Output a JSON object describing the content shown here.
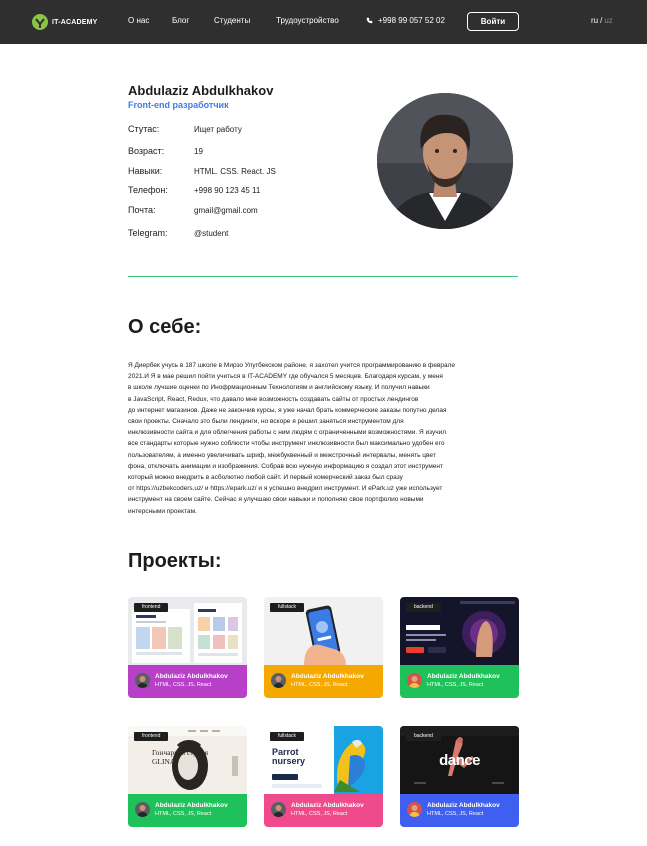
{
  "header": {
    "logo_text": "IT-ACADEMY",
    "nav": [
      "О нас",
      "Блог",
      "Студенты",
      "Трудоустройство"
    ],
    "phone": "+998 99 057 52 02",
    "login_label": "Войти",
    "lang_active": "ru",
    "lang_separator": "/",
    "lang_inactive": "uz",
    "colors": {
      "background": "#2f2f2f",
      "logo_green": "#8bc34a"
    }
  },
  "profile": {
    "name": "Abdulaziz Abdulkhakov",
    "role": "Front-end разработчик",
    "fields": [
      {
        "label": "Стутас:",
        "value": "Ищет работу"
      },
      {
        "label": "Возраст:",
        "value": "19"
      },
      {
        "label": "Навыки:",
        "value": "HTML. CSS. React. JS"
      },
      {
        "label": "Телефон:",
        "value": "+998 90 123 45 11"
      },
      {
        "label": "Почта:",
        "value": "gmail@gmail.com"
      },
      {
        "label": "Telegram:",
        "value": "@student"
      }
    ],
    "colors": {
      "role": "#3f7be8",
      "divider": "#3ec67c"
    }
  },
  "about": {
    "title": "О себе:",
    "lines": [
      "Я Диербек учусь в 187 школе в Мирзо Улугбекском районе. я захотел учится программированию в феврале",
      "2021.И Я в мае решил пойти учиться в IT-ACADEMY где обучался 5 месяцев. Благодаря курсам, у меня",
      "в школе лучшие оценки по Инофрмационным Технологиям и английскому языку. И получил навыки",
      "в JavaScript, React, Redux, что давало мне возможность создавать сайты от простых лендингов",
      "до интернет магазинов. Даже не закончив курсы, я уже начал брать коммерческие заказы попутно делая",
      "свои проекты. Сначало это были лендинги, но вскоре я решил заняться инструментом для",
      "инклюзивности сайта и для облегчения работы с ним людям с ограниченными возможностями. Я изучил",
      "все стандарты которые нужно соблюсти чтобы инструмент инклюзивности был максимально удобен его",
      "пользователям, а именно увеличивать шриф, межбуквенный и межстрочный интервалы, менять цвет",
      "фона, отключать анимации и изображения. Собрав всю нужную информацию я создал этот инструмент",
      "который можно внедрить в асболютно любой сайт. И первый комерческий заказ был сразу",
      "от https://uzbekcoders.uz/ и https://epark.uz/ и я успешно внедрил инструмент. И ePark.uz уже использует",
      "инструмент на своем сайте. Сейчас я улучшаю свои навыки и пополняю свое портфолио новыми",
      "интерсными проектам."
    ]
  },
  "projects": {
    "title": "Проекты:",
    "items": [
      {
        "tag": "frontend",
        "name": "Abdulaziz Abdulkhakov",
        "skills": "HTML, CSS, JS, React",
        "color": "#b83fc7",
        "thumb": "shop"
      },
      {
        "tag": "fullstack",
        "name": "Abdulaziz Abdulkhakov",
        "skills": "HTML, CSS, JS, React",
        "color": "#f5a800",
        "thumb": "phone"
      },
      {
        "tag": "backend",
        "name": "Abdulaziz Abdulkhakov",
        "skills": "HTML, CSS, JS, React",
        "color": "#1fc25a",
        "thumb": "game",
        "thumb_text": "CASH PRIZE"
      },
      {
        "tag": "frontend",
        "name": "Abdulaziz Abdulkhakov",
        "skills": "HTML, CSS, JS, React",
        "color": "#1fc25a",
        "thumb": "studio",
        "thumb_text": "Гончарная студия GLINA"
      },
      {
        "tag": "fullstack",
        "name": "Abdulaziz Abdulkhakov",
        "skills": "HTML, CSS, JS, React",
        "color": "#ef4b8c",
        "thumb": "parrot",
        "thumb_text": "Parrot nursery"
      },
      {
        "tag": "backend",
        "name": "Abdulaziz Abdulkhakov",
        "skills": "HTML, CSS, JS, React",
        "color": "#3f5ff0",
        "thumb": "dance",
        "thumb_text": "dance"
      }
    ]
  }
}
